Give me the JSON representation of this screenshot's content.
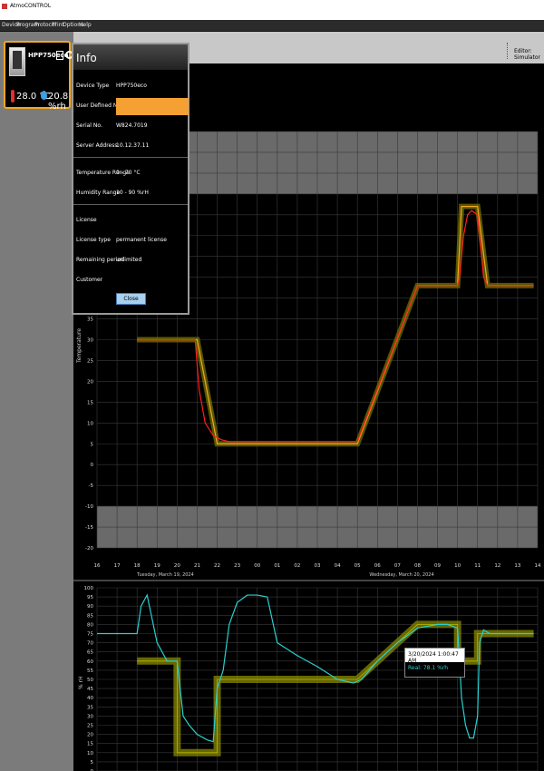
{
  "window": {
    "title": "AtmoCONTROL"
  },
  "menu": [
    "Device",
    "Program",
    "Protocol",
    "Print",
    "Options",
    "Help"
  ],
  "device": {
    "name": "HPP750eco",
    "temperature": "28.0 °C",
    "humidity": "20.8 %rh"
  },
  "toolbar": {
    "editor_label": "Editor: Simulator"
  },
  "info_dialog": {
    "title": "Info",
    "rows": [
      {
        "label": "Device Type",
        "value": "HPP750eco"
      },
      {
        "label": "User Defined Name",
        "value": ""
      },
      {
        "label": "Serial No.",
        "value": "W824.7019"
      },
      {
        "label": "Server Address",
        "value": "10.12.37.11"
      },
      {
        "label": "Temperature Range",
        "value": "0 - 70 °C"
      },
      {
        "label": "Humidity Range",
        "value": "10 - 90 %rH"
      },
      {
        "label": "License",
        "value": ""
      },
      {
        "label": "License type",
        "value": "permanent license"
      },
      {
        "label": "Remaining period",
        "value": "unlimited"
      },
      {
        "label": "Customer",
        "value": ""
      }
    ],
    "close_label": "Close"
  },
  "tooltip": {
    "datetime": "3/20/2024 1:00:47 AM",
    "real": "Real: 78.1 %rh"
  },
  "chart_data": [
    {
      "type": "line",
      "ylabel": "Temperature",
      "ylim": [
        -20,
        80
      ],
      "y_ticks": [
        80,
        75,
        70,
        65,
        60,
        55,
        50,
        45,
        40,
        35,
        30,
        25,
        20,
        15,
        10,
        5,
        0,
        -5,
        -10,
        -15,
        -20
      ],
      "x_ticks": [
        "16",
        "17",
        "18",
        "19",
        "20",
        "21",
        "22",
        "23",
        "00",
        "01",
        "02",
        "03",
        "04",
        "05",
        "06",
        "07",
        "08",
        "09",
        "10",
        "11",
        "12",
        "13",
        "14"
      ],
      "date_labels": [
        "Tuesday, March 19, 2024",
        "Wednesday, March 20, 2024"
      ],
      "shaded_bands": [
        [
          65,
          80
        ],
        [
          -20,
          -10
        ]
      ],
      "grid": true,
      "series": [
        {
          "color": "#f5a623",
          "x": [
            18.0,
            20.9,
            21.0,
            22.0,
            22.6,
            28.8,
            29.0,
            32.0,
            33.0,
            34.0,
            34.2,
            35.0,
            35.5,
            37.8
          ],
          "y": [
            30,
            30,
            30,
            5,
            5,
            5,
            5,
            43,
            43,
            43,
            62,
            62,
            43,
            43
          ]
        },
        {
          "color": "#ff2020",
          "x": [
            18.0,
            20.9,
            21.1,
            21.4,
            21.8,
            22.2,
            22.6,
            28.8,
            29.0,
            32.0,
            33.0,
            34.0,
            34.1,
            34.3,
            34.5,
            34.7,
            35.0,
            35.3,
            35.5,
            37.8
          ],
          "y": [
            30,
            30,
            18,
            10,
            7,
            6,
            5.5,
            5.5,
            5.5,
            43,
            43,
            43,
            45,
            55,
            60,
            61,
            60,
            45,
            43,
            43
          ]
        }
      ]
    },
    {
      "type": "line",
      "ylabel": "% rH",
      "ylim": [
        0,
        100
      ],
      "y_ticks": [
        100,
        95,
        90,
        85,
        80,
        75,
        70,
        65,
        60,
        55,
        50,
        45,
        40,
        35,
        30,
        25,
        20,
        15,
        10,
        5,
        0
      ],
      "grid": true,
      "series": [
        {
          "color": "#b8b800",
          "x": [
            18.0,
            20.0,
            20.0,
            22.0,
            22.0,
            28.8,
            29.0,
            32.0,
            33.0,
            34.0,
            34.0,
            35.0,
            35.0,
            37.8
          ],
          "y": [
            60,
            60,
            10,
            10,
            50,
            50,
            50,
            80,
            80,
            80,
            60,
            60,
            75,
            75
          ]
        },
        {
          "color": "#2ad0d0",
          "x": [
            16.0,
            18.0,
            18.2,
            18.5,
            19.0,
            19.5,
            20.0,
            20.3,
            20.6,
            21.0,
            21.5,
            21.8,
            22.0,
            22.3,
            22.6,
            23.0,
            23.5,
            24.0,
            24.5,
            25.0,
            26.0,
            27.0,
            28.0,
            28.8,
            29.2,
            30.0,
            31.0,
            32.0,
            33.0,
            33.5,
            34.0,
            34.1,
            34.2,
            34.4,
            34.6,
            34.8,
            35.0,
            35.1,
            35.3,
            35.6,
            36.0,
            37.0,
            37.8
          ],
          "y": [
            75,
            75,
            90,
            96,
            70,
            60,
            60,
            30,
            25,
            20,
            17,
            16,
            45,
            55,
            80,
            92,
            96,
            96,
            95,
            70,
            63,
            57,
            50,
            48,
            50,
            60,
            70,
            78,
            80,
            80,
            78,
            60,
            40,
            25,
            18,
            18,
            30,
            70,
            77,
            75,
            75,
            75,
            75
          ]
        }
      ]
    }
  ]
}
